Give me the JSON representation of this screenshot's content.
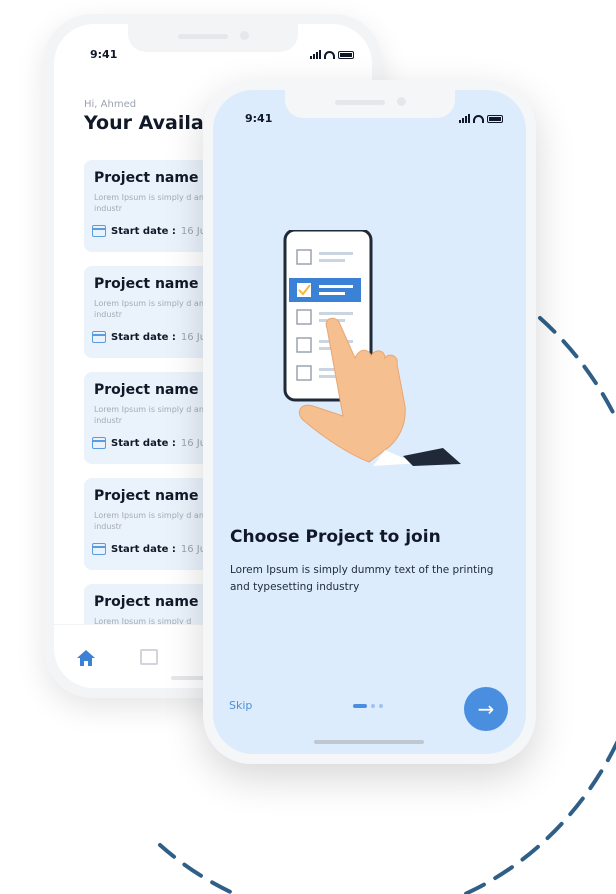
{
  "colors": {
    "accent": "#4a8ee0",
    "front_screen_bg": "#dcecfc",
    "card_bg": "#eaf2fc",
    "dashed_arc": "#2f5f86"
  },
  "back_phone": {
    "status_time": "9:41",
    "greeting": "Hi, Ahmed",
    "title": "Your Availab",
    "projects": [
      {
        "name": "Project name",
        "description": "Lorem Ipsum is simply d and typesetting industr",
        "date_label": "Start date :",
        "date_value": "16 Ju"
      },
      {
        "name": "Project name",
        "description": "Lorem Ipsum is simply d and typesetting industr",
        "date_label": "Start date :",
        "date_value": "16 Jul"
      },
      {
        "name": "Project name",
        "description": "Lorem Ipsum is simply d and typesetting industr",
        "date_label": "Start date :",
        "date_value": "16 Jul"
      },
      {
        "name": "Project name",
        "description": "Lorem Ipsum is simply d and typesetting industr",
        "date_label": "Start date :",
        "date_value": "16 Ju"
      },
      {
        "name": "Project name",
        "description": "Lorem Ipsum is simply d",
        "date_label": "",
        "date_value": ""
      }
    ],
    "nav_icons": [
      "home-icon",
      "calendar-icon"
    ]
  },
  "front_phone": {
    "status_time": "9:41",
    "illustration": "hand-tapping-checklist-phone-illustration",
    "title": "Choose Project to join",
    "description": "Lorem Ipsum is simply dummy text of the printing and typesetting industry",
    "skip_label": "Skip",
    "pager": {
      "current": 1,
      "total": 3
    },
    "next_icon": "arrow-right-icon",
    "next_glyph": "→"
  }
}
